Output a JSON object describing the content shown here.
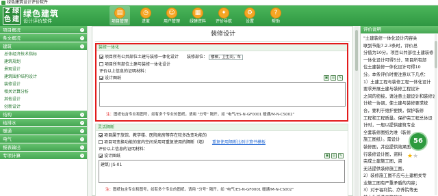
{
  "window": {
    "title": "绿色建筑设计评价软件"
  },
  "brand": {
    "logo_chars": [
      "Z",
      "绿",
      "色",
      "建"
    ],
    "name": "绿色建筑",
    "tagline": "设计评价软件"
  },
  "toolbar": [
    {
      "label": "项目管理",
      "icon": "folder-icon",
      "glyph": "▤",
      "active": true
    },
    {
      "label": "进度",
      "icon": "clock-icon",
      "glyph": "◷",
      "active": false
    },
    {
      "label": "用户管理",
      "icon": "user-icon",
      "glyph": "☺",
      "active": false
    },
    {
      "label": "绿建资料",
      "icon": "book-icon",
      "glyph": "▦",
      "active": false
    },
    {
      "label": "评价导航",
      "icon": "compass-icon",
      "glyph": "✦",
      "active": false
    },
    {
      "label": "设置",
      "icon": "gear-icon",
      "glyph": "⚙",
      "active": false
    },
    {
      "label": "帮助",
      "icon": "help-icon",
      "glyph": "?",
      "active": false
    }
  ],
  "sidebar": {
    "items": [
      {
        "type": "cat",
        "label": "项目概况"
      },
      {
        "type": "cat",
        "label": "条文概况"
      },
      {
        "type": "cat",
        "label": "建筑"
      },
      {
        "type": "sub",
        "label": "总体经济技术指标"
      },
      {
        "type": "sub",
        "label": "建筑规划"
      },
      {
        "type": "sub",
        "label": "景观设计"
      },
      {
        "type": "sub",
        "label": "建筑围护结构设计"
      },
      {
        "type": "sub",
        "label": "装修设计"
      },
      {
        "type": "sub",
        "label": "相关计算分析"
      },
      {
        "type": "sub",
        "label": "其他设计"
      },
      {
        "type": "sub",
        "label": "创新设计"
      },
      {
        "type": "cat",
        "label": "结构"
      },
      {
        "type": "cat",
        "label": "给排水"
      },
      {
        "type": "cat",
        "label": "暖通"
      },
      {
        "type": "cat",
        "label": "电气"
      },
      {
        "type": "cat",
        "label": "报表输出"
      },
      {
        "type": "cat",
        "label": "专项计算"
      }
    ]
  },
  "main": {
    "title": "装修设计",
    "section1": {
      "header": "装修一体化",
      "opt1": "项目所有公共部位土建与装修一体化设计",
      "part_label": "装修部位：",
      "part_value": "楼梯，卫生间，车",
      "opt2": "项目所有部位土建与装修一体化设计",
      "evidence_label": "评价以上信息的证明材料：",
      "design_drawing": "设计图纸",
      "note_star": "注：",
      "note": "图纸包含专业和图号，如有多个专业的图纸，请用 \"分号\" 隔开，如 \"电气/ES-N-GF0001 暖通/M-N-CS002\""
    },
    "section2": {
      "header": "灵活隔断",
      "opt1": "项目属于旅馆、教学楼、医院病房等存在较多改变功能的",
      "opt2": "项目可变换功能的室内空间采用可重复使用的隔断（墙）",
      "link": "重复使用隔断比例计算书模板",
      "evidence_label": "评价以上信息的证明材料：",
      "design_drawing": "设计图纸",
      "textbox_value": "建筑/ JS-01",
      "note_star": "注：",
      "note": "图纸包含专业和图号，如有多个专业的图纸，请用 \"分号\" 隔开，如 \"电气/ES-N-GF0001 暖通/M-N-CS002\""
    }
  },
  "right_panel": {
    "header": "评价说明",
    "lines": [
      "\"土建装修一体化设计内容关",
      "联到节能7.2.3条时，评价总",
      "分值为10分。项目公共部位土建装修",
      "一体化设计可得5分，项目所有部",
      "位土建装修一体化设计可得10",
      "分。本条评价时要注意以下几点：",
      "1）土建工程与装修工程一体化设计",
      "要求开展土建与装修工程设计",
      "之间的衔接，请注意土建设计和装修设",
      "计统一协调，使土建与装修要求统",
      "合，要利于维护更换，保护装修",
      "工程和工程质量。保护完工程总体设",
      "计时，一般以提供建筑专业",
      "全套装修图纸为准（装修",
      "施工图纸）。需设计",
      "装修图，并应提供效果图",
      "行装修设计图，资料",
      "完成土建施工图，资",
      "无法提供装修施工图，",
      "2）装修施工图不应与土建相关专",
      "业施工图有严重矛盾的内容；",
      "3）对于福利院、疗养院等无",
      "基本生活单元等建设"
    ],
    "score": "56",
    "rating_filled": 1,
    "rating_total": 2
  },
  "colors": {
    "accent_green": "#45a653",
    "highlight_red": "#e21b1b",
    "icon_orange": "#f5a623"
  }
}
